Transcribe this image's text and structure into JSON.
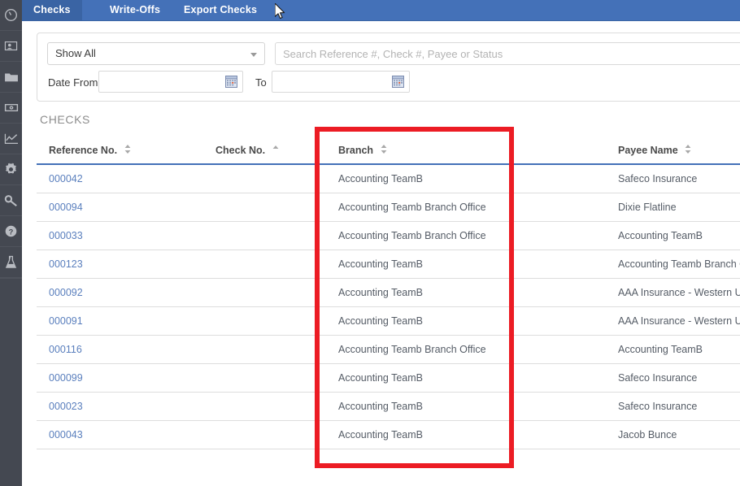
{
  "sidebar": {
    "items": [
      {
        "name": "dashboard-icon",
        "icon": "gauge"
      },
      {
        "name": "contacts-icon",
        "icon": "id-card"
      },
      {
        "name": "files-icon",
        "icon": "folder"
      },
      {
        "name": "payments-icon",
        "icon": "banknote"
      },
      {
        "name": "reports-icon",
        "icon": "line-chart"
      },
      {
        "name": "settings-icon",
        "icon": "gear"
      },
      {
        "name": "permissions-icon",
        "icon": "key"
      },
      {
        "name": "help-icon",
        "icon": "question-circle"
      },
      {
        "name": "tools-icon",
        "icon": "lab-flask"
      }
    ]
  },
  "tabs": [
    {
      "label": "Checks",
      "active": true
    },
    {
      "label": "Write-Offs",
      "active": false
    },
    {
      "label": "Export Checks",
      "active": false
    }
  ],
  "filters": {
    "status_select": {
      "value": "Show All"
    },
    "search": {
      "value": "",
      "placeholder": "Search Reference #, Check #, Payee or Status"
    },
    "date_from_label": "Date From",
    "date_from_value": "",
    "to_label": "To",
    "date_to_value": ""
  },
  "section": {
    "title": "CHECKS"
  },
  "table": {
    "columns": [
      {
        "label": "Reference No.",
        "sort": "none"
      },
      {
        "label": "Check No.",
        "sort": "asc"
      },
      {
        "label": "Branch",
        "sort": "none"
      },
      {
        "label": "Payee Name",
        "sort": "none"
      }
    ],
    "rows": [
      {
        "reference": "000042",
        "check": "",
        "branch": "Accounting TeamB",
        "payee": "Safeco Insurance"
      },
      {
        "reference": "000094",
        "check": "",
        "branch": "Accounting Teamb Branch Office",
        "payee": "Dixie Flatline"
      },
      {
        "reference": "000033",
        "check": "",
        "branch": "Accounting Teamb Branch Office",
        "payee": "Accounting TeamB"
      },
      {
        "reference": "000123",
        "check": "",
        "branch": "Accounting TeamB",
        "payee": "Accounting Teamb Branch Office"
      },
      {
        "reference": "000092",
        "check": "",
        "branch": "Accounting TeamB",
        "payee": "AAA Insurance - Western Union"
      },
      {
        "reference": "000091",
        "check": "",
        "branch": "Accounting TeamB",
        "payee": "AAA Insurance - Western Union"
      },
      {
        "reference": "000116",
        "check": "",
        "branch": "Accounting Teamb Branch Office",
        "payee": "Accounting TeamB"
      },
      {
        "reference": "000099",
        "check": "",
        "branch": "Accounting TeamB",
        "payee": "Safeco Insurance"
      },
      {
        "reference": "000023",
        "check": "",
        "branch": "Accounting TeamB",
        "payee": "Safeco Insurance"
      },
      {
        "reference": "000043",
        "check": "",
        "branch": "Accounting TeamB",
        "payee": "Jacob Bunce"
      }
    ]
  },
  "annotation": {
    "color": "#ec1c24",
    "target_column": "Branch"
  },
  "colors": {
    "tab_bar": "#4471b8",
    "tab_active": "#3a64a4",
    "sidebar": "#444851",
    "link": "#5a7fbd",
    "header_rule": "#4471b8"
  }
}
